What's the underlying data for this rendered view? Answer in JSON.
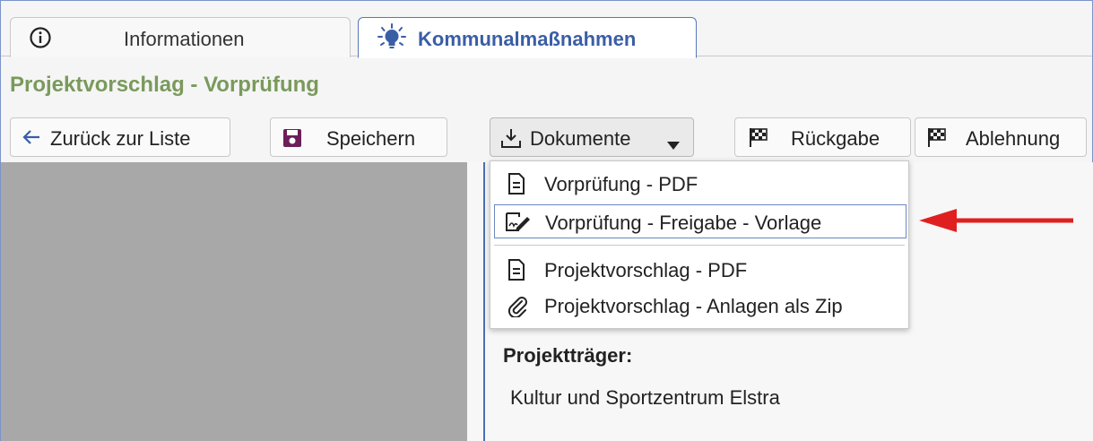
{
  "tabs": [
    {
      "label": "Informationen",
      "icon": "info-circle-icon"
    },
    {
      "label": "Kommunalmaßnahmen",
      "icon": "lightbulb-icon"
    }
  ],
  "page": {
    "title": "Projektvorschlag - Vorprüfung"
  },
  "toolbar": {
    "back_label": "Zurück zur Liste",
    "save_label": "Speichern",
    "docs_label": "Dokumente",
    "rueckgabe_label": "Rückgabe",
    "ablehnung_label": "Ablehnung"
  },
  "menu": {
    "items": [
      {
        "label": "Vorprüfung - PDF",
        "icon": "document-icon"
      },
      {
        "label": "Vorprüfung - Freigabe - Vorlage",
        "icon": "signature-icon"
      },
      {
        "label": "Projektvorschlag - PDF",
        "icon": "document-icon"
      },
      {
        "label": "Projektvorschlag - Anlagen als Zip",
        "icon": "paperclip-icon"
      }
    ]
  },
  "details": {
    "label": "Projektträger:",
    "value": "Kultur und Sportzentrum Elstra"
  },
  "colors": {
    "accent_blue": "#3a5ea6",
    "title_green": "#7a9a5c",
    "arrow_red": "#e02020",
    "save_icon_purple": "#6b1f5a"
  }
}
